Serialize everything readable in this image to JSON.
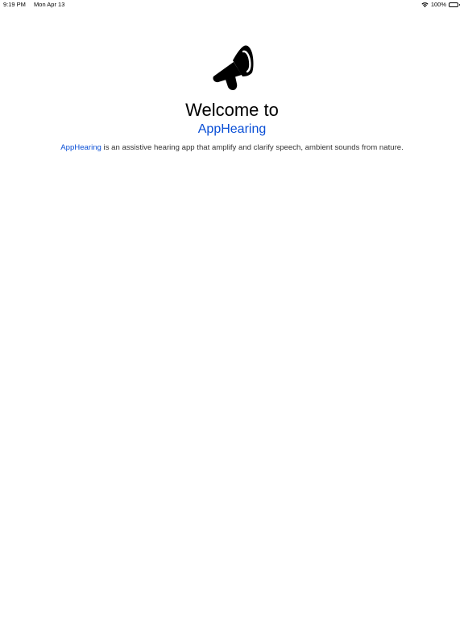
{
  "status_bar": {
    "time": "9:19 PM",
    "date": "Mon Apr 13",
    "battery": "100%"
  },
  "welcome": {
    "title": "Welcome to",
    "app_name": "AppHearing",
    "description_link": "AppHearing",
    "description_text": " is an assistive hearing app that amplify and clarify speech, ambient sounds from nature."
  },
  "colors": {
    "accent": "#0a4fd6"
  },
  "icons": {
    "logo": "megaphone-icon"
  }
}
